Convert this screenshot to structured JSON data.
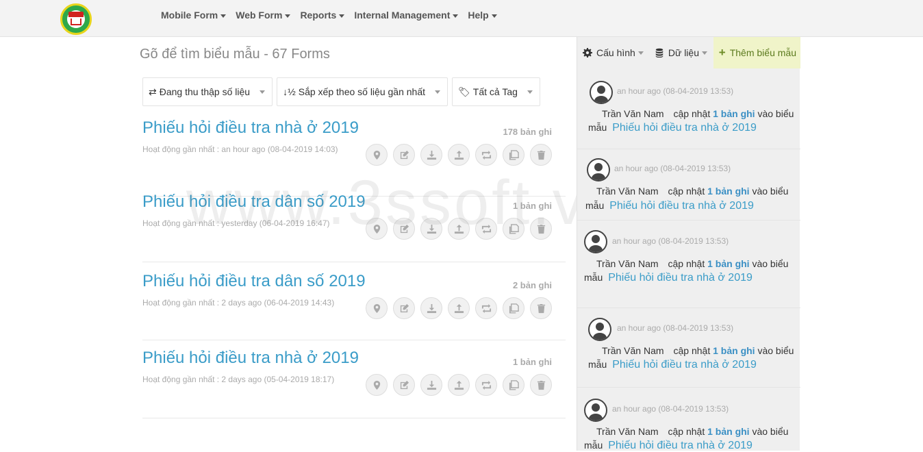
{
  "nav": {
    "items": [
      {
        "label": "Mobile Form"
      },
      {
        "label": "Web Form"
      },
      {
        "label": "Reports"
      },
      {
        "label": "Internal Management"
      },
      {
        "label": "Help"
      }
    ]
  },
  "search": {
    "title": "Gõ để tìm biểu mẫu - 67 Forms"
  },
  "filters": {
    "status": "Đang thu thập số liệu",
    "sort": "Sắp xếp theo số liệu gần nhất",
    "tags": "Tất cả Tag"
  },
  "forms": [
    {
      "title": "Phiếu hỏi điều tra nhà ở 2019",
      "count": "178 bản ghi",
      "activity": "Hoạt động gần nhất : an hour ago (08-04-2019 14:03)"
    },
    {
      "title": "Phiếu hỏi điều tra dân số 2019",
      "count": "1 bản ghi",
      "activity": "Hoạt động gần nhất : yesterday (06-04-2019 16:47)"
    },
    {
      "title": "Phiếu hỏi điều tra dân số 2019",
      "count": "2 bản ghi",
      "activity": "Hoạt động gần nhất : 2 days ago (06-04-2019 14:43)"
    },
    {
      "title": "Phiếu hỏi điều tra nhà ở 2019",
      "count": "1 bản ghi",
      "activity": "Hoạt động gần nhất : 2 days ago (05-04-2019 18:17)"
    }
  ],
  "watermark": "www.3ssoft.vn",
  "right_panel": {
    "config_label": "Cấu hình",
    "data_label": "Dữ liệu",
    "add_label": "Thêm biểu mẫu",
    "activities": [
      {
        "time": "an hour ago (08-04-2019 13:53)",
        "user": "Trần Văn Nam",
        "verb": "cập nhật",
        "count": "1 bản ghi",
        "into": "vào biểu",
        "into2": "mẫu",
        "form": "Phiếu hỏi điều tra nhà ở 2019"
      },
      {
        "time": "an hour ago (08-04-2019 13:53)",
        "user": "Trần Văn Nam",
        "verb": "cập nhật",
        "count": "1 bản ghi",
        "into": "vào biểu",
        "into2": "mẫu",
        "form": "Phiếu hỏi điều tra nhà ở 2019"
      },
      {
        "time": "an hour ago (08-04-2019 13:53)",
        "user": "Trần Văn Nam",
        "verb": "cập nhật",
        "count": "1 bản ghi",
        "into": "vào biểu",
        "into2": "mẫu",
        "form": "Phiếu hỏi điều tra nhà ở 2019"
      },
      {
        "time": "an hour ago (08-04-2019 13:53)",
        "user": "Trần Văn Nam",
        "verb": "cập nhật",
        "count": "1 bản ghi",
        "into": "vào biểu",
        "into2": "mẫu",
        "form": "Phiếu hỏi điều tra nhà ở 2019"
      },
      {
        "time": "an hour ago (08-04-2019 13:53)",
        "user": "Trần Văn Nam",
        "verb": "cập nhật",
        "count": "1 bản ghi",
        "into": "vào biểu",
        "into2": "mẫu",
        "form": "Phiếu hỏi điều tra nhà ở 2019"
      }
    ]
  }
}
